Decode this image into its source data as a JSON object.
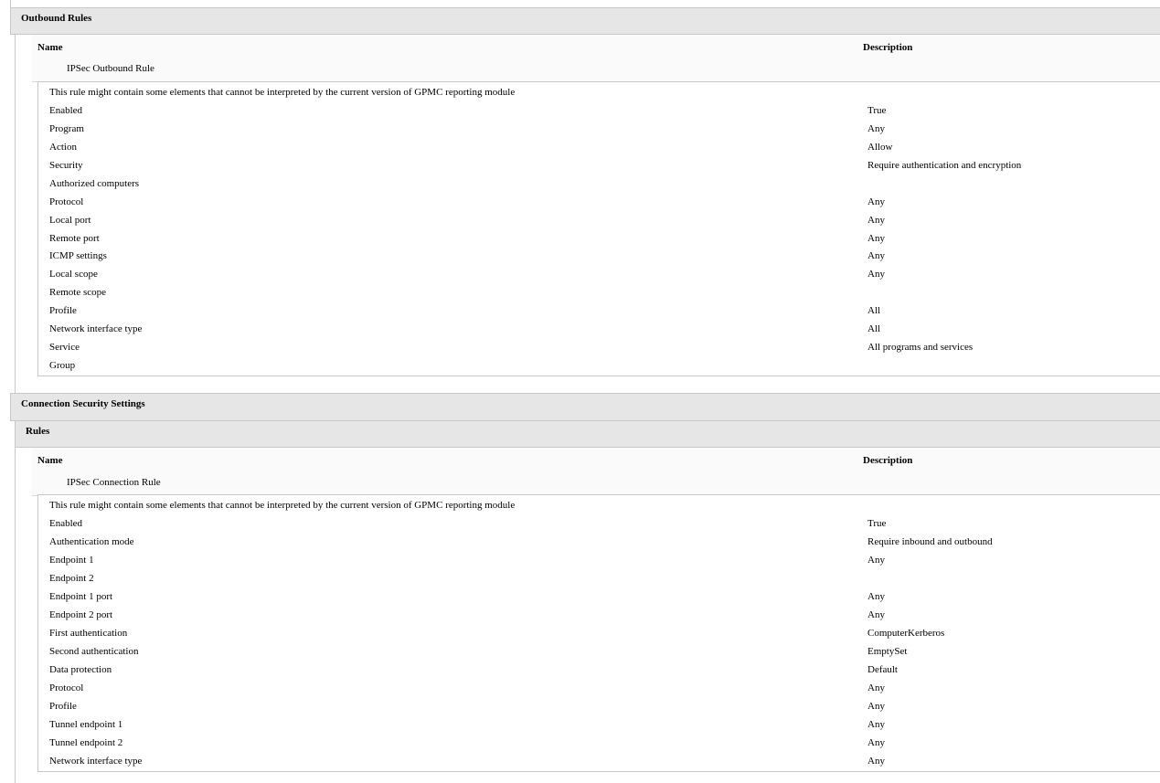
{
  "outbound": {
    "title": "Outbound Rules",
    "col_name": "Name",
    "col_description": "Description",
    "rule_name": "IPSec Outbound Rule",
    "note": "This rule might contain some elements that cannot be interpreted by the current version of GPMC reporting module",
    "props": [
      {
        "label": "Enabled",
        "value": "True"
      },
      {
        "label": "Program",
        "value": "Any"
      },
      {
        "label": "Action",
        "value": "Allow"
      },
      {
        "label": "Security",
        "value": "Require authentication and encryption"
      },
      {
        "label": "Authorized computers",
        "value": ""
      },
      {
        "label": "Protocol",
        "value": "Any"
      },
      {
        "label": "Local port",
        "value": "Any"
      },
      {
        "label": "Remote port",
        "value": "Any"
      },
      {
        "label": "ICMP settings",
        "value": "Any"
      },
      {
        "label": "Local scope",
        "value": "Any"
      },
      {
        "label": "Remote scope",
        "value": ""
      },
      {
        "label": "Profile",
        "value": "All"
      },
      {
        "label": "Network interface type",
        "value": "All"
      },
      {
        "label": "Service",
        "value": "All programs and services"
      },
      {
        "label": "Group",
        "value": ""
      }
    ]
  },
  "connection": {
    "title": "Connection Security Settings",
    "rules_title": "Rules",
    "col_name": "Name",
    "col_description": "Description",
    "rule_name": "IPSec Connection Rule",
    "note": "This rule might contain some elements that cannot be interpreted by the current version of GPMC reporting module",
    "props": [
      {
        "label": "Enabled",
        "value": "True"
      },
      {
        "label": "Authentication mode",
        "value": "Require inbound and outbound"
      },
      {
        "label": "Endpoint 1",
        "value": "Any"
      },
      {
        "label": "Endpoint 2",
        "value": ""
      },
      {
        "label": "Endpoint 1 port",
        "value": "Any"
      },
      {
        "label": "Endpoint 2 port",
        "value": "Any"
      },
      {
        "label": "First authentication",
        "value": "ComputerKerberos"
      },
      {
        "label": "Second authentication",
        "value": "EmptySet"
      },
      {
        "label": "Data protection",
        "value": "Default"
      },
      {
        "label": "Protocol",
        "value": "Any"
      },
      {
        "label": "Profile",
        "value": "Any"
      },
      {
        "label": "Tunnel endpoint 1",
        "value": "Any"
      },
      {
        "label": "Tunnel endpoint 2",
        "value": "Any"
      },
      {
        "label": "Network interface type",
        "value": "Any"
      }
    ]
  }
}
